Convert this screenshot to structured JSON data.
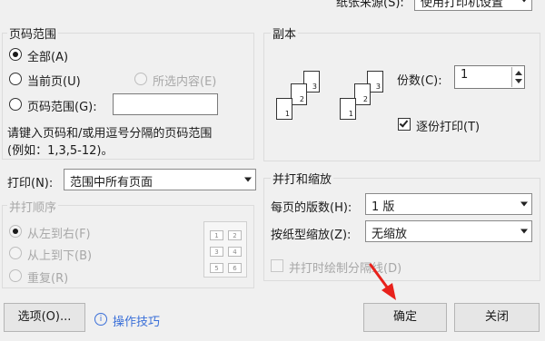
{
  "top": {
    "paper_source_label": "纸张来源(S):",
    "paper_source_value": "使用打印机设置"
  },
  "page_range": {
    "title": "页码范围",
    "all_label": "全部(A)",
    "current_label": "当前页(U)",
    "selection_label": "所选内容(E)",
    "pages_label": "页码范围(G):",
    "pages_value": "",
    "hint_line1": "请键入页码和/或用逗号分隔的页码范围",
    "hint_line2": "(例如：1,3,5-12)。"
  },
  "copies": {
    "title": "副本",
    "count_label": "份数(C):",
    "count_value": "1",
    "collate_label": "逐份打印(T)",
    "collate_checked": true
  },
  "print_what": {
    "label": "打印(N):",
    "value": "范围中所有页面"
  },
  "order": {
    "title": "并打顺序",
    "left_to_right": "从左到右(F)",
    "top_to_bottom": "从上到下(B)",
    "repeat": "重复(R)",
    "grid_numbers": [
      "1",
      "2",
      "3",
      "4",
      "5",
      "6"
    ]
  },
  "zoom": {
    "title": "并打和缩放",
    "pages_per_sheet_label": "每页的版数(H):",
    "pages_per_sheet_value": "1 版",
    "scale_label": "按纸型缩放(Z):",
    "scale_value": "无缩放",
    "draw_borders_label": "并打时绘制分隔线(D)"
  },
  "footer": {
    "options_button": "选项(O)...",
    "tips_link": "操作技巧",
    "ok_button": "确定",
    "close_button": "关闭"
  },
  "colors": {
    "accent": "#3a6fd8",
    "arrow": "#e8211b",
    "background": "#f0f0f0"
  },
  "icons": {
    "tips": "info-circle-icon",
    "collate_preview": "stacked-pages-icon"
  }
}
